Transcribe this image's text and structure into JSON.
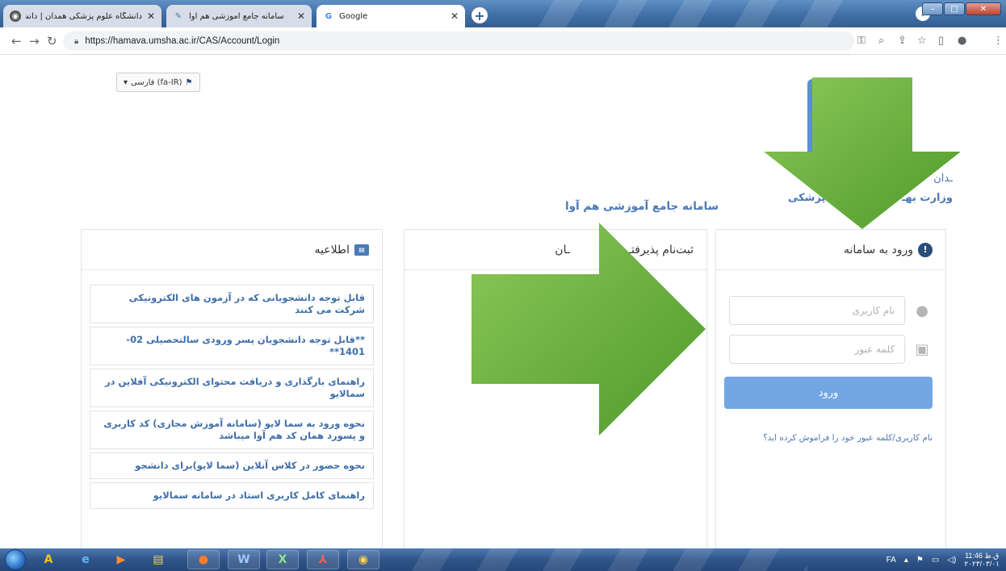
{
  "browser": {
    "tabs": [
      {
        "title": "دانشگاه علوم پزشکی همدان | دانشگاه علوم ...",
        "active": false,
        "favicon": "globe-icon"
      },
      {
        "title": "سامانه جامع آموزشی هم آوا",
        "active": true,
        "favicon": "hamava-icon"
      },
      {
        "title": "Google",
        "active": false,
        "favicon": "google-icon"
      }
    ],
    "url": "https://hamava.umsha.ac.ir/CAS/Account/Login"
  },
  "page": {
    "language_selector": "فارسی (fa-IR)",
    "logo_text_line1": "دانشگاه علوم پزشکی همدان",
    "logo_text_line1_visible": "ـدان",
    "logo_text_line2_left": "وزارت بهـ",
    "logo_text_line2_right": "ـوزش پزشکی",
    "system_title": "سامانه جامع آموزشی هم آوا"
  },
  "login_panel": {
    "title": "ورود به سامانه",
    "username_placeholder": "نام کاربری",
    "password_placeholder": "کلمه عبور",
    "login_button": "ورود",
    "forgot_link": "نام کاربری/کلمه عبور خود را فراموش کرده اید؟"
  },
  "registration_panel": {
    "title_left": "ثبت‌نام پذیرفتـ",
    "title_right": "ـان"
  },
  "news_panel": {
    "title": "اطلاعیه",
    "items": [
      "قابل توجه دانشجویانی که در آزمون های الکترونیکی شرکت می کنند",
      "**قابل توجه دانشجویان پسر ورودی سالتحصیلی 02-1401**",
      "راهنمای بارگذاری و دریافت محتوای الکترونیکی آفلاین در سمالایو",
      "نحوه ورود به سما لایو (سامانه آموزش مجازی) کد کاربری و پسورد همان کد هم آوا میباشد",
      "نحوه حضور در کلاس آنلاین (سما لایو)برای دانشجو",
      "راهنمای کامل کاربری استاد در سامانه سمالایو"
    ]
  },
  "taskbar": {
    "lang": "FA",
    "time": "11:46 ق.ظ",
    "date": "۲۰۲۳/۰۳/۰۱"
  },
  "colors": {
    "arrow_green": "#6fb33a",
    "link_blue": "#4a79b5",
    "login_button": "#72a7e3"
  }
}
